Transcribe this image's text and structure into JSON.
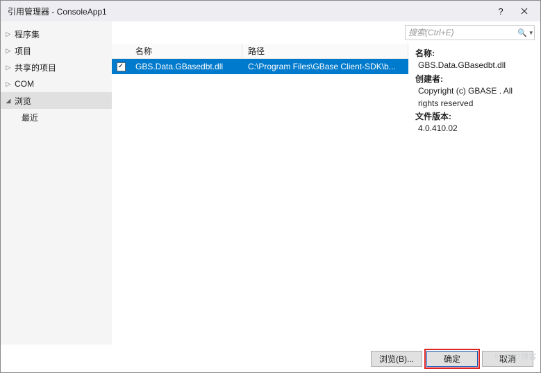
{
  "title": "引用管理器 - ConsoleApp1",
  "sidebar": {
    "items": [
      {
        "label": "程序集",
        "expanded": false
      },
      {
        "label": "项目",
        "expanded": false
      },
      {
        "label": "共享的项目",
        "expanded": false
      },
      {
        "label": "COM",
        "expanded": false
      },
      {
        "label": "浏览",
        "expanded": true,
        "children": [
          {
            "label": "最近"
          }
        ]
      }
    ]
  },
  "search": {
    "placeholder": "搜索(Ctrl+E)"
  },
  "columns": {
    "name": "名称",
    "path": "路径"
  },
  "rows": [
    {
      "checked": true,
      "name": "GBS.Data.GBasedbt.dll",
      "path": "C:\\Program Files\\GBase Client-SDK\\b..."
    }
  ],
  "details": {
    "name_label": "名称:",
    "name_value": "GBS.Data.GBasedbt.dll",
    "creator_label": "创建者:",
    "creator_value": "Copyright (c) GBASE .  All rights reserved",
    "version_label": "文件版本:",
    "version_value": "4.0.410.02"
  },
  "footer": {
    "browse": "浏览(B)...",
    "ok": "确定",
    "cancel": "取消"
  },
  "watermark": "51CTO博客"
}
